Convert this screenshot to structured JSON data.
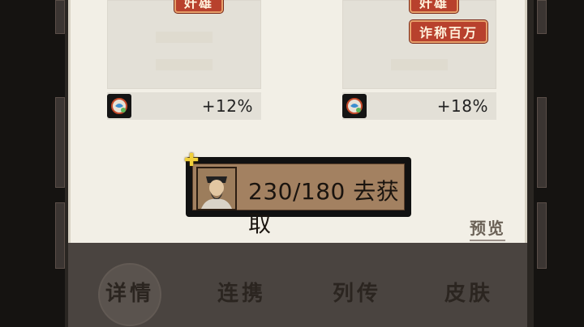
{
  "cards": [
    {
      "tags": [
        "奸雄"
      ],
      "bonus": "+12%"
    },
    {
      "tags": [
        "奸雄",
        "诈称百万"
      ],
      "bonus": "+18%"
    }
  ],
  "acquire": {
    "label": "230/180 去获取"
  },
  "preview": {
    "label": "预览"
  },
  "tabs": [
    {
      "label": "详情"
    },
    {
      "label": "连携"
    },
    {
      "label": "列传"
    },
    {
      "label": "皮肤"
    }
  ],
  "colors": {
    "panel": "#f2efe6",
    "tag": "#b8412d",
    "button": "#a38161"
  },
  "icons": {
    "stat": "bird-orb-icon",
    "portrait": "general-portrait-icon"
  }
}
